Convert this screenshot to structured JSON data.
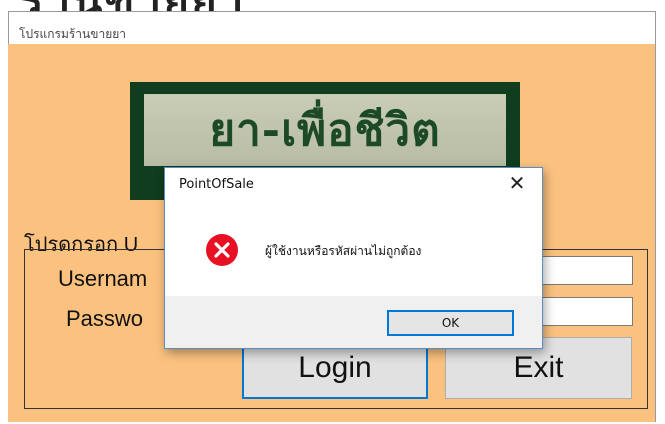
{
  "background_fragment": "ร้านขายยา",
  "window": {
    "title": "โปรแกรมร้านขายยา"
  },
  "logo": {
    "text": "ยา-เพื่อชีวิต"
  },
  "login_group": {
    "legend": "โปรดกรอก U",
    "username_label": "Usernam",
    "password_label": "Passwo",
    "username_value": "",
    "password_value": "",
    "login_label": "Login",
    "exit_label": "Exit"
  },
  "message_box": {
    "title": "PointOfSale",
    "close_glyph": "✕",
    "icon": "error-icon",
    "text": "ผู้ใช้งานหรือรหัสผ่านไม่ถูกต้อง",
    "ok_label": "OK"
  },
  "colors": {
    "form_background": "#fbc27f",
    "logo_frame": "#0f3d1e",
    "error_red": "#e81123",
    "focus_blue": "#0078d7"
  }
}
